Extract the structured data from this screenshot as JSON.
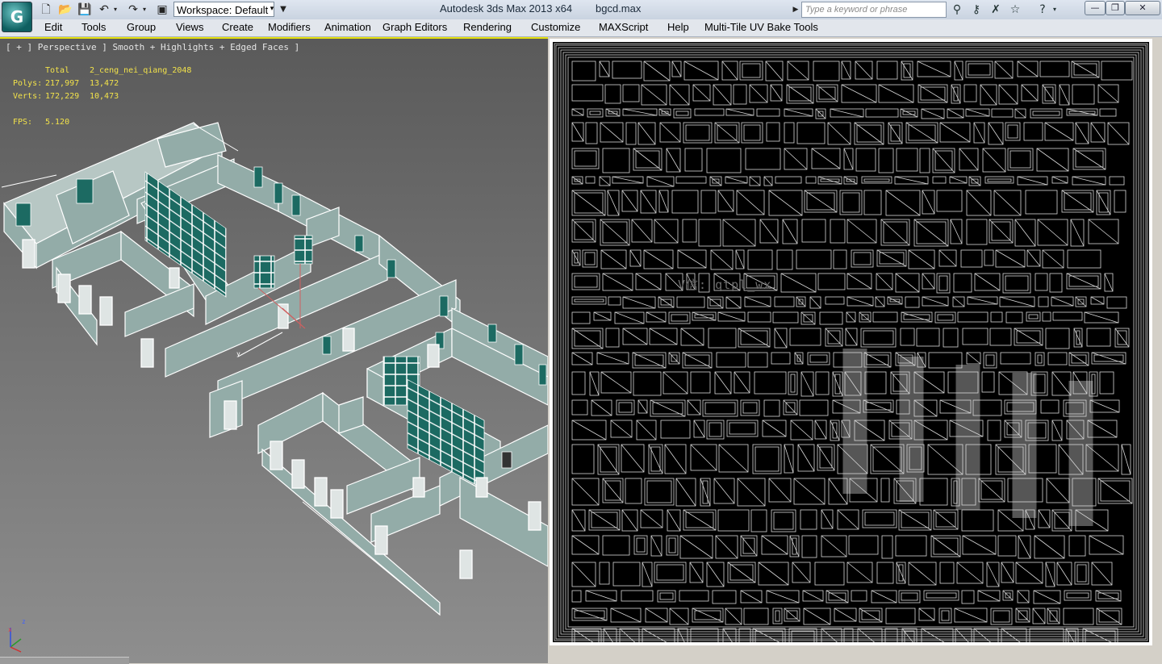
{
  "titlebar": {
    "app_title": "Autodesk 3ds Max  2013 x64",
    "file_title": "bgcd.max",
    "workspace_value": "Workspace: Default",
    "search_placeholder": "Type a keyword or phrase",
    "logo_glyph": "G"
  },
  "menu": [
    "Edit",
    "Tools",
    "Group",
    "Views",
    "Create",
    "Modifiers",
    "Animation",
    "Graph Editors",
    "Rendering",
    "Customize",
    "MAXScript",
    "Help",
    "Multi-Tile UV Bake Tools"
  ],
  "viewport_left": {
    "label": "[ + ] Perspective ] Smooth + Highlights + Edged Faces ]",
    "stats": {
      "total_header": "Total",
      "object_header": "2_ceng_nei_qiang_2048",
      "polys_label": "Polys:",
      "polys_total": "217,997",
      "polys_object": "13,472",
      "verts_label": "Verts:",
      "verts_total": "172,229",
      "verts_object": "10,473",
      "fps_label": "FPS:",
      "fps_value": "5.120"
    },
    "axis_labels": {
      "x": "x",
      "y": "y",
      "z": "z"
    }
  },
  "viewport_right": {
    "watermark": "V信: qtpl_wx"
  },
  "colors": {
    "active_border": "#e6e010",
    "stats_text": "#f2e24a",
    "wall": "#91aaa6",
    "window_glass": "#1c6a62",
    "uv_line": "#d8d8d8"
  }
}
